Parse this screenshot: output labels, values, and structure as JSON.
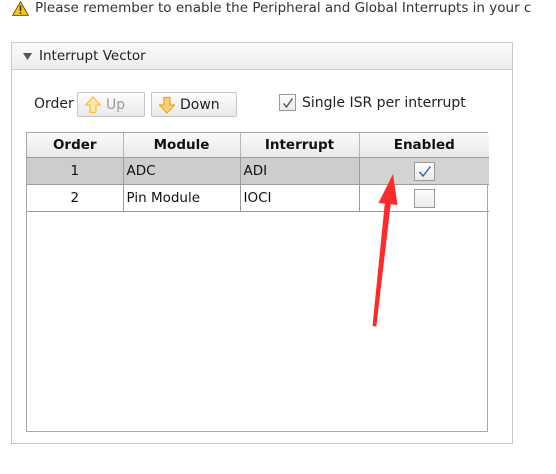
{
  "warning": {
    "icon": "warning-icon",
    "text": "Please remember to enable the Peripheral and Global Interrupts in your c"
  },
  "panel": {
    "title": "Interrupt Vector",
    "collapse_icon": "triangle-down-icon"
  },
  "toolbar": {
    "order_label": "Order",
    "up_label": "Up",
    "up_enabled": false,
    "down_label": "Down",
    "down_enabled": true,
    "single_isr_label": "Single ISR per interrupt",
    "single_isr_checked": true
  },
  "table": {
    "headers": {
      "order": "Order",
      "module": "Module",
      "interrupt": "Interrupt",
      "enabled": "Enabled"
    },
    "rows": [
      {
        "order": "1",
        "module": "ADC",
        "interrupt": "ADI",
        "enabled": true,
        "selected": true
      },
      {
        "order": "2",
        "module": "Pin Module",
        "interrupt": "IOCI",
        "enabled": false,
        "selected": false
      }
    ]
  },
  "colors": {
    "annotation_arrow": "#ff2a2a",
    "warning_fill": "#f5c518",
    "up_arrow": "#f6c244",
    "down_arrow": "#f0a020"
  }
}
